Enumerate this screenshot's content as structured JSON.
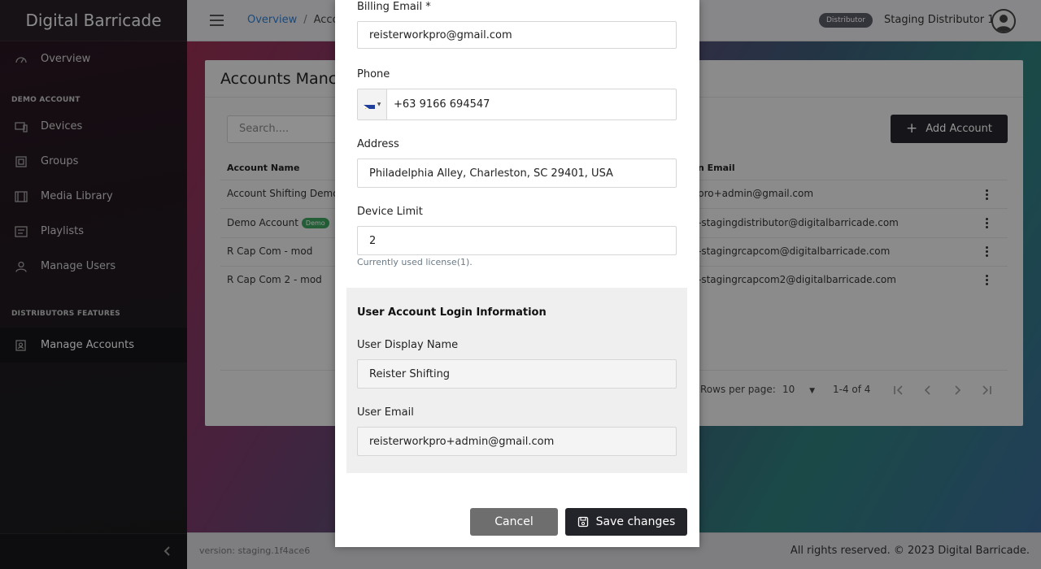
{
  "sidebar": {
    "brand": "Digital Barricade",
    "overview_label": "Overview",
    "section_demo": "DEMO ACCOUNT",
    "items": [
      {
        "label": "Devices",
        "icon": "devices-icon"
      },
      {
        "label": "Groups",
        "icon": "groups-icon"
      },
      {
        "label": "Media Library",
        "icon": "media-library-icon"
      },
      {
        "label": "Playlists",
        "icon": "playlists-icon"
      },
      {
        "label": "Manage Users",
        "icon": "users-icon"
      }
    ],
    "section_distributors": "DISTRIBUTORS FEATURES",
    "active_item": "Manage Accounts"
  },
  "topbar": {
    "breadcrumb_link": "Overview",
    "breadcrumb_sep": "/",
    "breadcrumb_current": "Accou",
    "role_badge": "Distributor",
    "user_name": "Staging Distributor 1"
  },
  "page": {
    "title": "Accounts Manc",
    "search_placeholder": "Search....",
    "add_button": "Add Account",
    "columns": {
      "name": "Account Name",
      "email": "n Email"
    },
    "rows": [
      {
        "name": "Account Shifting Demo",
        "badge": "",
        "email": "pro+admin@gmail.com"
      },
      {
        "name": "Demo Account",
        "badge": "Demo",
        "email": "-stagingdistributor@digitalbarricade.com"
      },
      {
        "name": "R Cap Com - mod",
        "badge": "",
        "email": "-stagingrcapcom@digitalbarricade.com"
      },
      {
        "name": "R Cap Com 2 - mod",
        "badge": "",
        "email": "-stagingrcapcom2@digitalbarricade.com"
      }
    ],
    "pagination": {
      "rows_label": "Rows per page:",
      "rows_value": "10",
      "range": "1-4 of 4"
    }
  },
  "footer": {
    "version": "version: staging.1f4ace6",
    "rights": "All rights reserved. © 2023 Digital Barricade."
  },
  "modal": {
    "billing_email_label": "Billing Email *",
    "billing_email_value": "reisterworkpro@gmail.com",
    "phone_label": "Phone",
    "phone_value": "+63 9166 694547",
    "address_label": "Address",
    "address_value": "Philadelphia Alley, Charleston, SC 29401, USA",
    "device_limit_label": "Device Limit",
    "device_limit_value": "2",
    "device_limit_hint": "Currently used license(1).",
    "login_section_title": "User Account Login Information",
    "display_name_label": "User Display Name",
    "display_name_value": "Reister Shifting",
    "user_email_label": "User Email",
    "user_email_value": "reisterworkpro+admin@gmail.com",
    "cancel_label": "Cancel",
    "save_label": "Save changes"
  },
  "colors": {
    "accent_dark": "#23232a",
    "link": "#2f7fd1",
    "demo_badge": "#3da35d"
  }
}
